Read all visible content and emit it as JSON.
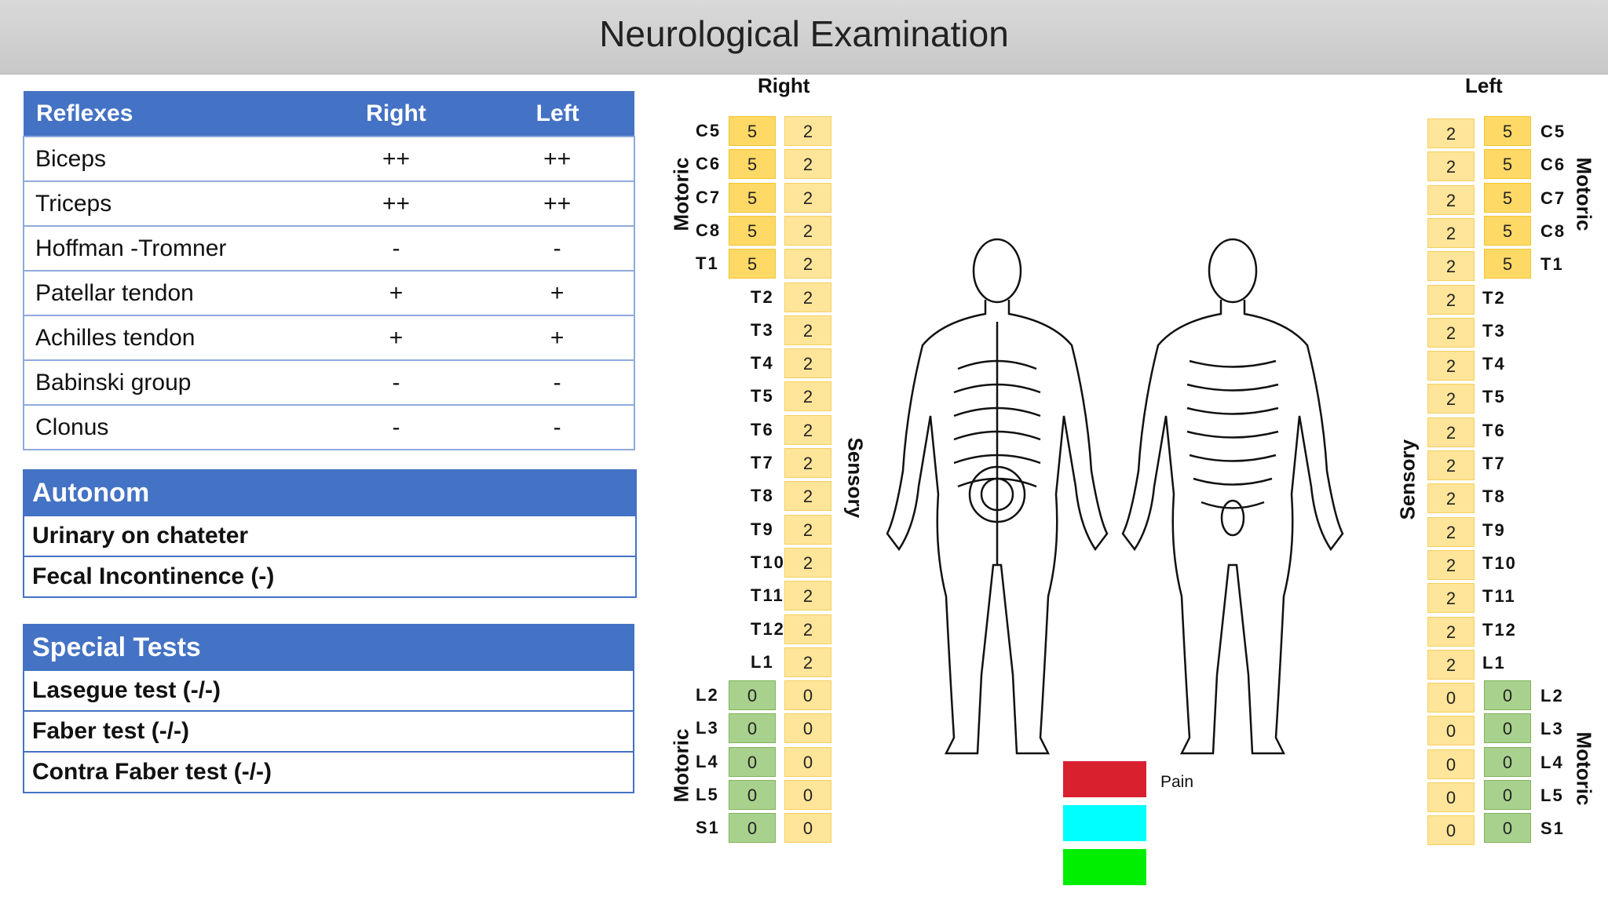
{
  "title": "Neurological Examination",
  "reflexes": {
    "headers": [
      "Reflexes",
      "Right",
      "Left"
    ],
    "rows": [
      [
        "Biceps",
        "++",
        "++"
      ],
      [
        "Triceps",
        "++",
        "++"
      ],
      [
        "Hoffman -Tromner",
        "-",
        "-"
      ],
      [
        "Patellar tendon",
        "+",
        "+"
      ],
      [
        "Achilles tendon",
        "+",
        "+"
      ],
      [
        "Babinski group",
        "-",
        "-"
      ],
      [
        "Clonus",
        "-",
        "-"
      ]
    ]
  },
  "autonom": {
    "header": "Autonom",
    "rows": [
      "Urinary on chateter",
      "Fecal Incontinence (-)"
    ]
  },
  "special_tests": {
    "header": "Special Tests",
    "rows": [
      "Lasegue test (-/-)",
      "Faber test (-/-)",
      "Contra Faber test (-/-)"
    ]
  },
  "dermatome": {
    "right_label": "Right",
    "left_label": "Left",
    "motoric_label": "Motoric",
    "sensory_label": "Sensory",
    "right_levels": [
      "C5",
      "C6",
      "C7",
      "C8",
      "T1",
      "T2",
      "T3",
      "T4",
      "T5",
      "T6",
      "T7",
      "T8",
      "T9",
      "T10",
      "T11",
      "T12",
      "L1",
      "L2",
      "L3",
      "L4",
      "L5",
      "S1"
    ],
    "right_motor": [
      "5",
      "5",
      "5",
      "5",
      "5",
      "",
      "",
      "",
      "",
      "",
      "",
      "",
      "",
      "",
      "",
      "",
      "",
      "0",
      "0",
      "0",
      "0",
      "0"
    ],
    "right_sensory": [
      "2",
      "2",
      "2",
      "2",
      "2",
      "2",
      "2",
      "2",
      "2",
      "2",
      "2",
      "2",
      "2",
      "2",
      "2",
      "2",
      "2",
      "0",
      "0",
      "0",
      "0",
      "0"
    ],
    "left_levels": [
      "C5",
      "C6",
      "C7",
      "C8",
      "T1",
      "T2",
      "T3",
      "T4",
      "T5",
      "T6",
      "T7",
      "T8",
      "T9",
      "T10",
      "T11",
      "T12",
      "L1",
      "L2",
      "L3",
      "L4",
      "L5",
      "S1"
    ],
    "left_motor": [
      "5",
      "5",
      "5",
      "5",
      "5",
      "",
      "",
      "",
      "",
      "",
      "",
      "",
      "",
      "",
      "",
      "",
      "",
      "0",
      "0",
      "0",
      "0",
      "0"
    ],
    "left_sensory": [
      "2",
      "2",
      "2",
      "2",
      "2",
      "2",
      "2",
      "2",
      "2",
      "2",
      "2",
      "2",
      "2",
      "2",
      "2",
      "2",
      "2",
      "0",
      "0",
      "0",
      "0",
      "0"
    ]
  },
  "legend": {
    "items": [
      {
        "label": "Pain",
        "color": "#d9202f"
      },
      {
        "label": "",
        "color": "#00ffff"
      },
      {
        "label": "",
        "color": "#00ee00"
      }
    ]
  }
}
